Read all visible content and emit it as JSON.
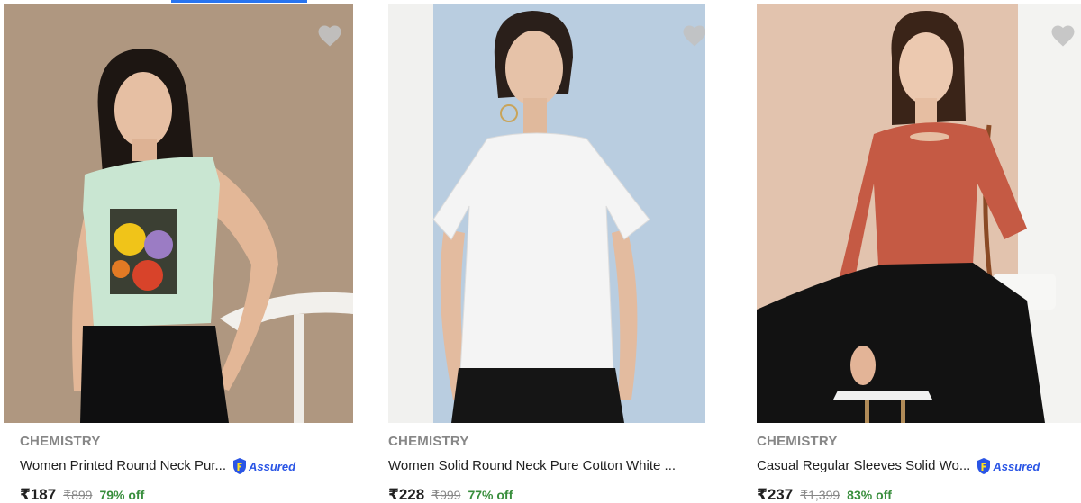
{
  "products": [
    {
      "brand": "CHEMISTRY",
      "title": "Women Printed Round Neck Pur...",
      "assured": "Assured",
      "price": "₹187",
      "mrp": "₹899",
      "discount": "79% off"
    },
    {
      "brand": "CHEMISTRY",
      "title": "Women Solid Round Neck Pure Cotton White ...",
      "assured": "",
      "price": "₹228",
      "mrp": "₹999",
      "discount": "77% off"
    },
    {
      "brand": "CHEMISTRY",
      "title": "Casual Regular Sleeves Solid Wo...",
      "assured": "Assured",
      "price": "₹237",
      "mrp": "₹1,399",
      "discount": "83% off"
    }
  ],
  "colors": {
    "accent": "#2874f0",
    "discount": "#388e3c",
    "assured": "#2a55e5",
    "wishlist_heart": "#c2c2c2"
  },
  "icons": [
    "heart-icon",
    "assured-badge-icon"
  ]
}
